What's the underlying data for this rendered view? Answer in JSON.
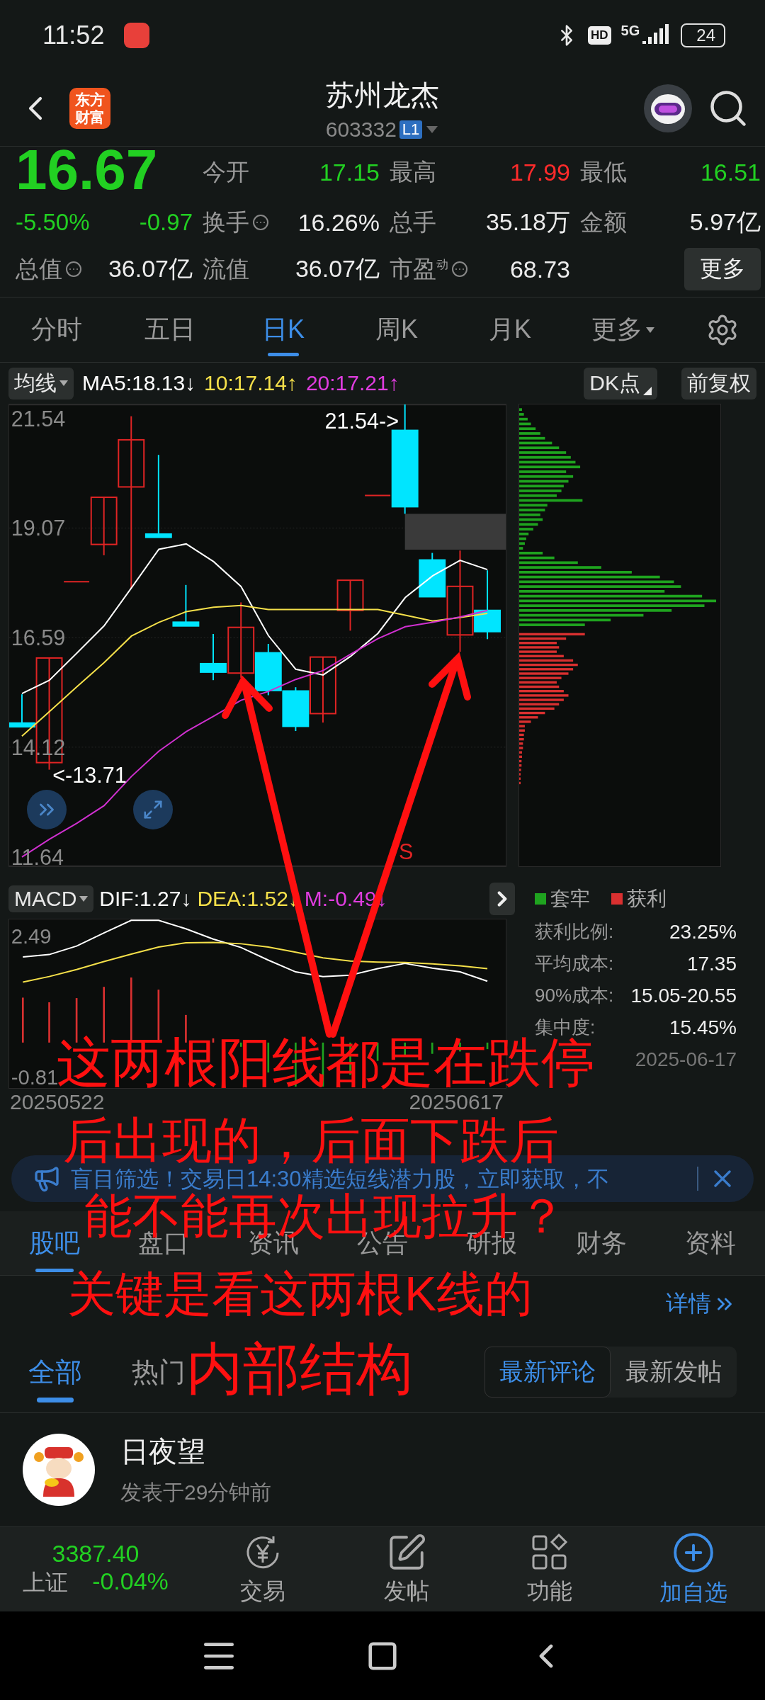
{
  "status_bar": {
    "time": "11:52",
    "hd_badge": "HD",
    "network": "5G",
    "battery": "24"
  },
  "header": {
    "logo": [
      "东方",
      "财富"
    ],
    "title": "苏州龙杰",
    "code": "603332",
    "level_badge": "L1"
  },
  "quote": {
    "price": "16.67",
    "change_percent": "-5.50%",
    "change": "-0.97",
    "color": "#22d022",
    "stats": [
      {
        "label": "今开",
        "value": "17.15",
        "color": "#22d022",
        "info": false
      },
      {
        "label": "最高",
        "value": "17.99",
        "color": "#ff2b2b",
        "info": false
      },
      {
        "label": "最低",
        "value": "16.51",
        "color": "#22d022",
        "info": false
      },
      {
        "label": "换手",
        "value": "16.26%",
        "color": "#ececec",
        "info": true
      },
      {
        "label": "总手",
        "value": "35.18万",
        "color": "#ececec",
        "info": false
      },
      {
        "label": "金额",
        "value": "5.97亿",
        "color": "#ececec",
        "info": false
      },
      {
        "label": "总值",
        "value": "36.07亿",
        "color": "#ececec",
        "info": true
      },
      {
        "label": "流值",
        "value": "36.07亿",
        "color": "#ececec",
        "info": false
      },
      {
        "label": "市盈$^{动}$",
        "value": "68.73",
        "color": "#ececec",
        "info": true
      }
    ],
    "more_button": "更多"
  },
  "period_tabs": [
    {
      "label": "分时",
      "selected": false,
      "dropdown": false
    },
    {
      "label": "五日",
      "selected": false,
      "dropdown": false
    },
    {
      "label": "日K",
      "selected": true,
      "dropdown": false
    },
    {
      "label": "周K",
      "selected": false,
      "dropdown": false
    },
    {
      "label": "月K",
      "selected": false,
      "dropdown": false
    },
    {
      "label": "更多",
      "selected": false,
      "dropdown": true
    }
  ],
  "indicator_bar": {
    "selector": "均线",
    "values": [
      {
        "text": "MA5:18.13↓",
        "color": "#ffffff"
      },
      {
        "text": "10:17.14↑",
        "color": "#f5e04a"
      },
      {
        "text": "20:17.21↑",
        "color": "#e03de0"
      }
    ],
    "buttons": [
      {
        "label": "DK点",
        "kind": "dropdown"
      },
      {
        "label": "前复权",
        "kind": "plain"
      }
    ]
  },
  "kline": {
    "high_mark": "21.54->",
    "low_mark": "<-13.71",
    "signal": "S",
    "chart_data": {
      "type": "line",
      "grid": true,
      "ylim": [
        11.43,
        21.86
      ],
      "bands": [
        {
          "axis": "y",
          "from": 18.58,
          "to": 19.39,
          "color": "#3a3a3a"
        }
      ],
      "yticks": [
        21.54,
        19.07,
        16.59,
        14.12,
        11.64
      ],
      "series": [
        {
          "color": "#ffffff",
          "values": [
            15.33,
            15.63,
            16.24,
            16.86,
            17.72,
            18.59,
            18.71,
            18.31,
            17.75,
            16.64,
            15.88,
            15.75,
            16.17,
            16.69,
            17.5,
            17.99,
            18.34,
            18.13
          ]
        },
        {
          "color": "#f5e04a",
          "values": [
            14.37,
            14.92,
            15.48,
            16.03,
            16.63,
            16.94,
            17.18,
            17.28,
            17.32,
            17.23,
            17.23,
            17.23,
            17.23,
            17.23,
            17.1,
            16.97,
            17.05,
            17.14
          ]
        },
        {
          "color": "#d030d0",
          "values": [
            11.64,
            12.04,
            12.4,
            12.8,
            13.46,
            14.03,
            14.47,
            14.82,
            15.18,
            15.38,
            15.65,
            15.85,
            16.22,
            16.57,
            16.84,
            16.94,
            17.06,
            17.21
          ]
        }
      ]
    }
  },
  "chips": {
    "legend": [
      {
        "label": "套牢",
        "color": "#1fa31f"
      },
      {
        "label": "获利",
        "color": "#d93030"
      }
    ],
    "stats": [
      {
        "label": "获利比例:",
        "value": "23.25%"
      },
      {
        "label": "平均成本:",
        "value": "17.35"
      },
      {
        "label": "90%成本:",
        "value": "15.05-20.55"
      },
      {
        "label": "集中度:",
        "value": "15.45%"
      }
    ],
    "date": "2025-06-17"
  },
  "macd": {
    "selector": "MACD",
    "values": [
      {
        "text": "DIF:1.27↓",
        "color": "#ffffff"
      },
      {
        "text": "DEA:1.52↓",
        "color": "#f5e04a"
      },
      {
        "text": "M:-0.49↓",
        "color": "#e03de0"
      }
    ],
    "y_labels": [
      "2.49",
      "-0.81"
    ],
    "dates": [
      "20250522",
      "20250617"
    ]
  },
  "banner": {
    "text": "盲目筛选！交易日14:30精选短线潜力股，立即获取，不"
  },
  "section_tabs": [
    {
      "label": "股吧",
      "selected": true
    },
    {
      "label": "盘口",
      "selected": false
    },
    {
      "label": "资讯",
      "selected": false
    },
    {
      "label": "公告",
      "selected": false
    },
    {
      "label": "研报",
      "selected": false
    },
    {
      "label": "财务",
      "selected": false
    },
    {
      "label": "资料",
      "selected": false
    }
  ],
  "ranking": {
    "link": "详情"
  },
  "feed_tabs": [
    {
      "label": "全部",
      "selected": true
    },
    {
      "label": "热门",
      "selected": false
    }
  ],
  "sort_toggle": [
    {
      "label": "最新评论",
      "selected": true
    },
    {
      "label": "最新发帖",
      "selected": false
    }
  ],
  "post": {
    "author": "日夜望",
    "time": "发表于29分钟前"
  },
  "bottom_nav": {
    "index": {
      "value": "3387.40",
      "name": "上证",
      "change": "-0.04%"
    },
    "items": [
      {
        "label": "交易",
        "kind": "trade",
        "highlighted": false
      },
      {
        "label": "发帖",
        "kind": "post",
        "highlighted": false
      },
      {
        "label": "功能",
        "kind": "tools",
        "highlighted": false
      },
      {
        "label": "加自选",
        "kind": "add",
        "highlighted": true
      }
    ]
  },
  "annotation": {
    "lines": [
      "这两根阳线都是在跌停",
      "后出现的，后面下跌后",
      "能不能再次出现拉升？",
      "关键是看这两根K线的",
      "内部结构"
    ]
  }
}
